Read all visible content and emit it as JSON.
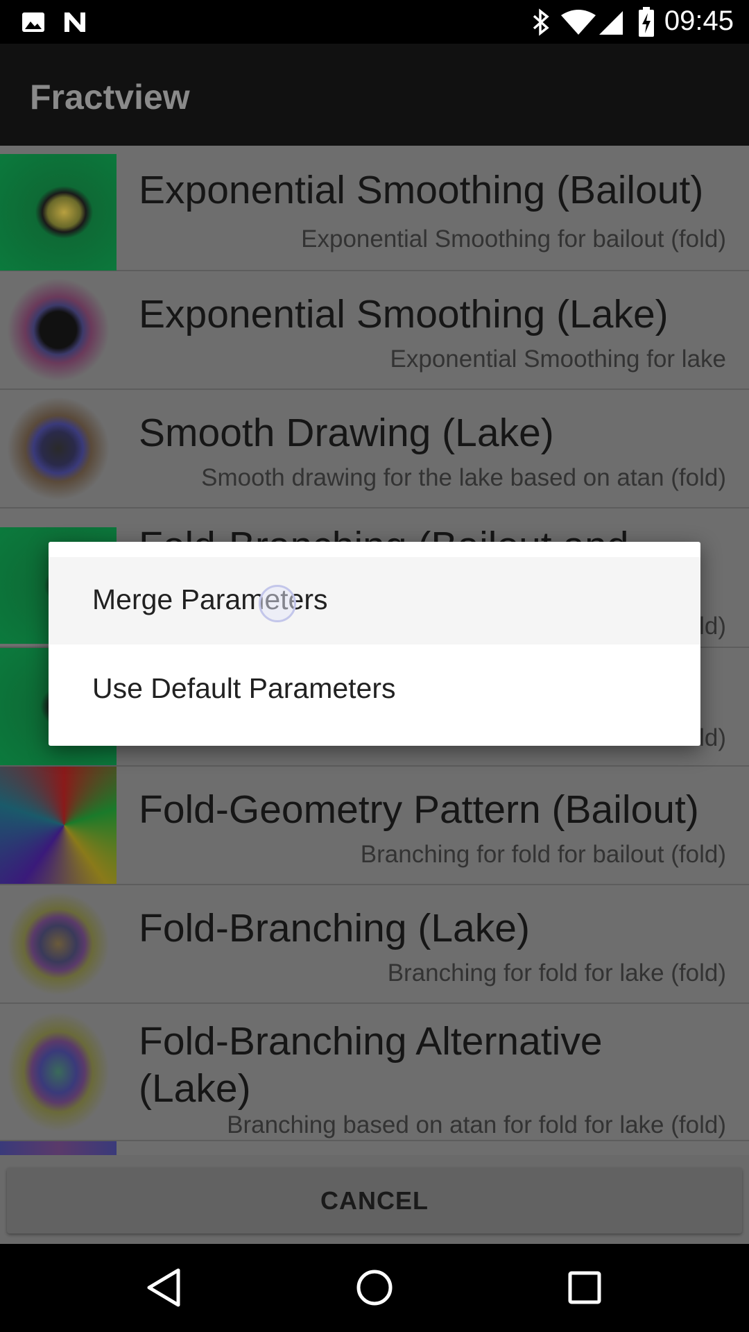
{
  "status_bar": {
    "time": "09:45",
    "icons": [
      "image-notification-icon",
      "n-notification-icon",
      "bluetooth-icon",
      "wifi-icon",
      "signal-icon",
      "battery-charging-icon"
    ]
  },
  "app_bar": {
    "title": "Fractview"
  },
  "list": {
    "items": [
      {
        "title": "Exponential Smoothing (Bailout)",
        "subtitle": "Exponential Smoothing for bailout (fold)"
      },
      {
        "title": "Exponential Smoothing (Lake)",
        "subtitle": "Exponential Smoothing for lake"
      },
      {
        "title": "Smooth Drawing (Lake)",
        "subtitle": "Smooth drawing for the lake based on atan (fold)"
      },
      {
        "title": "Fold-Branching (Bailout and",
        "subtitle": "ld)"
      },
      {
        "title": "",
        "subtitle": "ld)"
      },
      {
        "title": "Fold-Geometry Pattern (Bailout)",
        "subtitle": "Branching for fold for bailout (fold)"
      },
      {
        "title": "Fold-Branching (Lake)",
        "subtitle": "Branching for fold for lake (fold)"
      },
      {
        "title": "Fold-Branching Alternative (Lake)",
        "subtitle": "Branching based on atan for fold for lake (fold)"
      }
    ]
  },
  "dialog": {
    "options": [
      "Merge Parameters",
      "Use Default Parameters"
    ]
  },
  "cancel_label": "CANCEL",
  "colors": {
    "dim_overlay": "#6e6e6e",
    "app_bar": "#111111",
    "dialog_bg": "#ffffff",
    "pressed_item": "#f5f5f5",
    "ripple": "#c3c6ea"
  }
}
